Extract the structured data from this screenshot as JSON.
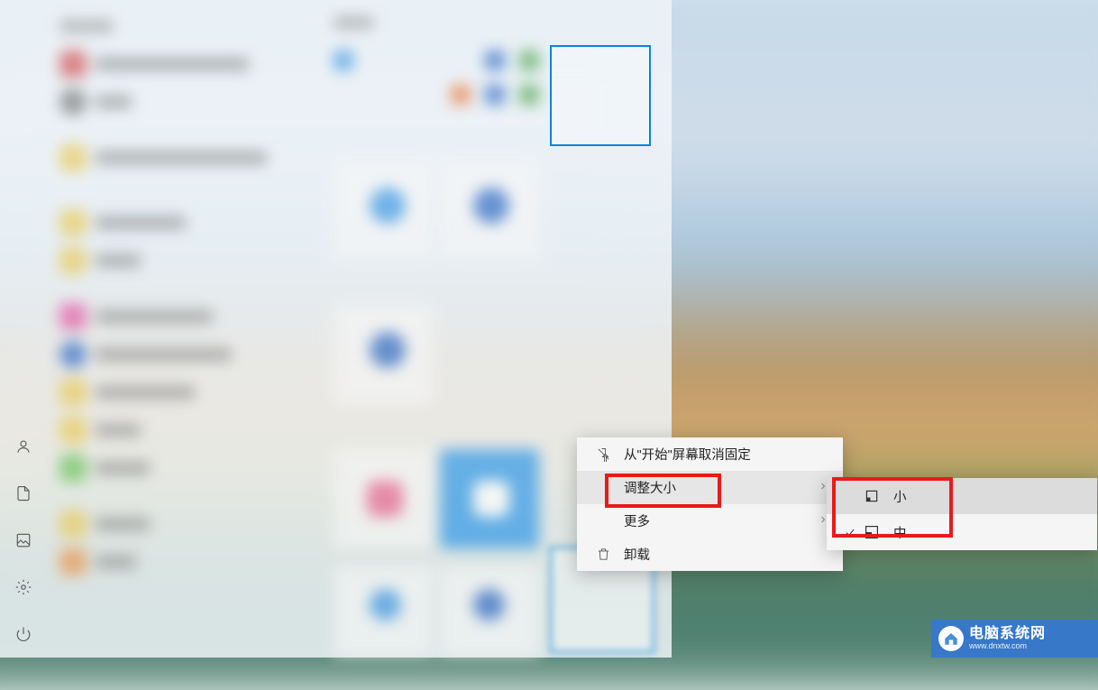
{
  "context_menu": {
    "unpin": "从\"开始\"屏幕取消固定",
    "resize": "调整大小",
    "more": "更多",
    "uninstall": "卸载"
  },
  "submenu": {
    "small": "小",
    "medium": "中"
  },
  "watermark": {
    "title": "电脑系统网",
    "sub": "www.dnxtw.com"
  },
  "app_icons": [
    "#e8a030",
    "#d04848",
    "#707070",
    "#e8c850",
    "#e8c850",
    "#e050a0",
    "#2060c0",
    "#e8c850",
    "#e8c850",
    "#60c050",
    "#e8c850",
    "#e89040"
  ]
}
